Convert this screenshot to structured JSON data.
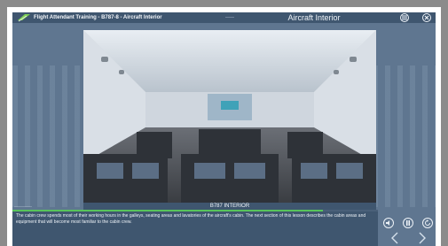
{
  "header": {
    "course_title": "Flight Attendant Training - B787-8 - Aircraft Interior",
    "center_mark": "——",
    "section_title": "Aircraft Interior",
    "buttons": [
      {
        "icon": "menu-icon"
      },
      {
        "icon": "close-icon"
      }
    ]
  },
  "main": {
    "image_caption": "B787 INTERIOR",
    "small_label": "—————"
  },
  "progress": {
    "fraction": 0.85
  },
  "body": {
    "text": "The cabin crew spends most of their working hours in the galleys, seating areas and lavatories of the aircraft's cabin. The next section of this lesson describes the cabin areas and equipment that will become most familiar to the cabin crew."
  },
  "controls": [
    {
      "icon": "audio-icon"
    },
    {
      "icon": "pause-icon"
    },
    {
      "icon": "replay-icon"
    }
  ],
  "nav": [
    {
      "icon": "previous-icon"
    },
    {
      "icon": "next-icon"
    }
  ],
  "colors": {
    "header": "#3f566f",
    "panel": "#5f7690",
    "accent": "#58c45b"
  }
}
